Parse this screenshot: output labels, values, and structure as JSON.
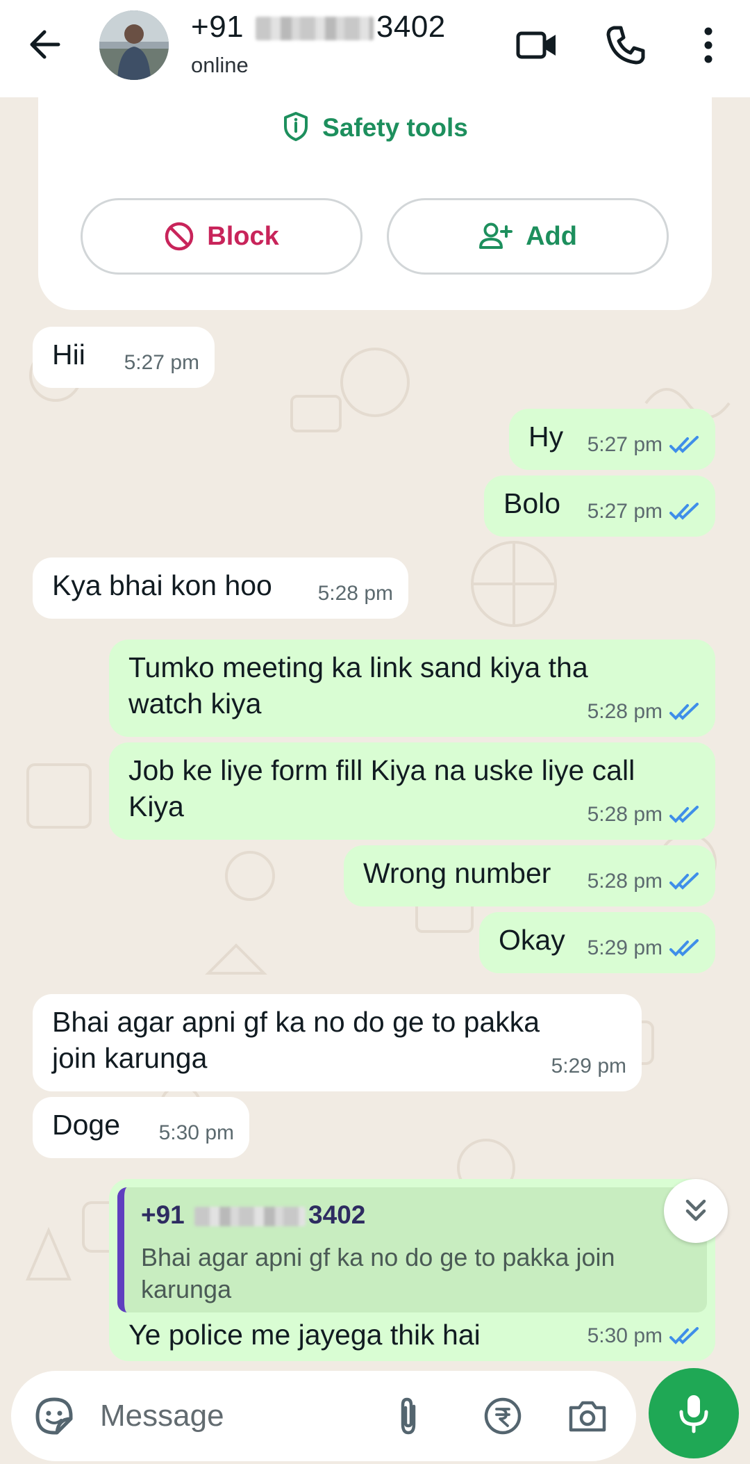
{
  "header": {
    "title_prefix": "+91",
    "title_suffix": "3402",
    "status": "online"
  },
  "safety": {
    "tools_label": "Safety tools",
    "block_label": "Block",
    "add_label": "Add"
  },
  "messages": [
    {
      "dir": "in",
      "text": "Hii",
      "time": "5:27 pm"
    },
    {
      "dir": "out",
      "text": "Hy",
      "time": "5:27 pm"
    },
    {
      "dir": "out",
      "text": "Bolo",
      "time": "5:27 pm"
    },
    {
      "dir": "in",
      "text": "Kya bhai kon hoo",
      "time": "5:28 pm"
    },
    {
      "dir": "out",
      "text": "Tumko meeting ka link sand kiya tha watch kiya",
      "time": "5:28 pm"
    },
    {
      "dir": "out",
      "text": "Job ke liye form fill Kiya na uske liye call Kiya",
      "time": "5:28 pm"
    },
    {
      "dir": "out",
      "text": "Wrong number",
      "time": "5:28 pm"
    },
    {
      "dir": "out",
      "text": "Okay",
      "time": "5:29 pm"
    },
    {
      "dir": "in",
      "text": "Bhai agar apni gf ka no do ge to pakka join karunga",
      "time": "5:29 pm"
    },
    {
      "dir": "in",
      "text": "Doge",
      "time": "5:30 pm"
    },
    {
      "dir": "out",
      "text": "Ye police me jayega thik hai",
      "time": "5:30 pm",
      "reply_to": {
        "name_prefix": "+91",
        "name_suffix": "3402",
        "text": "Bhai agar apni gf ka no do ge to pakka join karunga"
      }
    }
  ],
  "input": {
    "placeholder": "Message"
  },
  "colors": {
    "accent_green": "#1d8f5d",
    "outgoing_bubble": "#d9fdd3",
    "incoming_bubble": "#ffffff",
    "block_red": "#c8245a",
    "read_tick_blue": "#3f8ee9",
    "wallpaper": "#f1ebe3",
    "mic_button": "#1fa855"
  },
  "icons": {
    "back": "arrow-left-icon",
    "video": "video-camera-icon",
    "call": "phone-icon",
    "menu": "more-vertical-icon",
    "safety": "shield-icon",
    "block": "block-icon",
    "add": "add-contact-icon",
    "sticker": "sticker-icon",
    "attach": "paperclip-icon",
    "payment": "rupee-icon",
    "camera": "camera-icon",
    "mic": "microphone-icon",
    "scroll": "double-chevron-down-icon",
    "ticks": "double-check-icon"
  }
}
